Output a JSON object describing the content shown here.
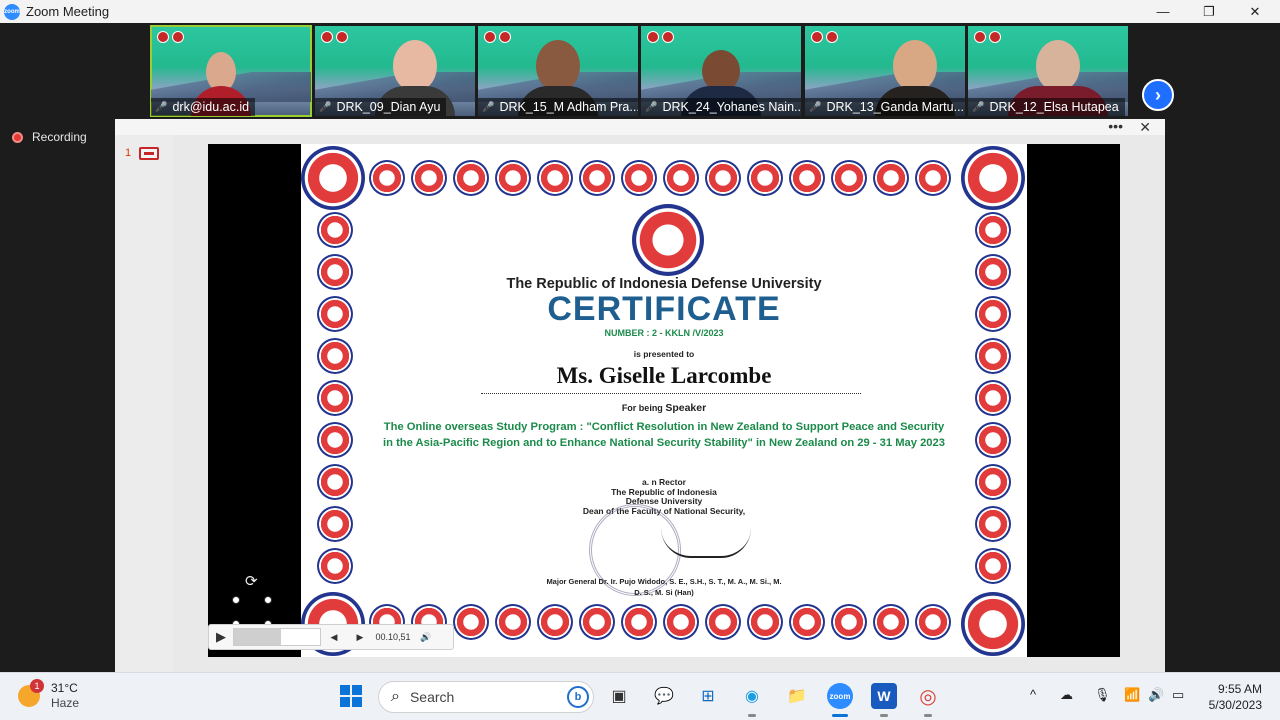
{
  "window": {
    "title": "Zoom Meeting",
    "app_icon": "zoom",
    "controls": {
      "minimize": "—",
      "maximize": "❐",
      "close": "✕"
    }
  },
  "gallery": {
    "tiles": [
      {
        "name": "drk@idu.ac.id",
        "mic": "microphone-icon",
        "active": true
      },
      {
        "name": "DRK_09_Dian Ayu",
        "mic": "microphone-muted-icon",
        "active": false
      },
      {
        "name": "DRK_15_M Adham Pra...",
        "mic": "microphone-muted-icon",
        "active": false
      },
      {
        "name": "DRK_24_Yohanes Nain...",
        "mic": "microphone-muted-icon",
        "active": false
      },
      {
        "name": "DRK_13_Ganda Martu...",
        "mic": "microphone-muted-icon",
        "active": false
      },
      {
        "name": "DRK_12_Elsa Hutapea",
        "mic": "microphone-muted-icon",
        "active": false
      }
    ],
    "next_glyph": "›"
  },
  "recording": {
    "label": "Recording"
  },
  "share": {
    "menu_glyph": "•••",
    "close_glyph": "✕",
    "slide_number": "1"
  },
  "certificate": {
    "university": "The Republic of Indonesia Defense University",
    "title": "CERTIFICATE",
    "number": "NUMBER : 2 - KKLN /V/2023",
    "presented_to": "is presented to",
    "recipient": "Ms. Giselle Larcombe",
    "for_being_prefix": "For being ",
    "for_being_role": "Speaker",
    "program": "The Online overseas Study Program : \"Conflict Resolution in New Zealand to Support Peace and Security in the Asia-Pacific Region and to Enhance National Security Stability\" in New Zealand on 29 - 31 May 2023",
    "sign_line1": "a. n Rector",
    "sign_line2": "The Republic of Indonesia",
    "sign_line3": "Defense University",
    "sign_line4": "Dean of the Faculty of National Security,",
    "signatory_line1": "Major General Dr. Ir. Pujo Widodo, S. E., S.H., S. T., M. A., M. Si., M.",
    "signatory_line2": "D. S., M. Si (Han)"
  },
  "media": {
    "time": "00.10,51",
    "play_glyph": "▶",
    "back_glyph": "◀",
    "fwd_glyph": "▶",
    "volume_glyph": "🔊",
    "progress": 0.55
  },
  "taskbar": {
    "weather": {
      "temp": "31°C",
      "condition": "Haze",
      "badge": "1"
    },
    "search_placeholder": "Search",
    "bing_glyph": "b",
    "apps": [
      {
        "id": "task-view",
        "glyph": "▣",
        "running": false
      },
      {
        "id": "teams-chat",
        "glyph": "💬",
        "running": false
      },
      {
        "id": "microsoft-store",
        "glyph": "⊞",
        "running": false
      },
      {
        "id": "edge",
        "glyph": "◉",
        "running": true
      },
      {
        "id": "file-explorer",
        "glyph": "📁",
        "running": false
      },
      {
        "id": "zoom",
        "glyph": "zoom",
        "running": true,
        "active": true
      },
      {
        "id": "word",
        "glyph": "W",
        "running": true
      },
      {
        "id": "chrome",
        "glyph": "◎",
        "running": true
      }
    ],
    "tray": {
      "chevron": "^",
      "cloud": "☁",
      "mic": "🎙",
      "wifi": "📶",
      "volume": "🔊",
      "battery": "▭"
    },
    "clock": {
      "time": "9:55 AM",
      "date": "5/30/2023"
    }
  },
  "colors": {
    "zoom_blue": "#2d8cff",
    "recording_red": "#e53935",
    "cert_title_blue": "#1f5f8f",
    "cert_green": "#1b8a4a",
    "tile_active_border": "#9acd32"
  }
}
